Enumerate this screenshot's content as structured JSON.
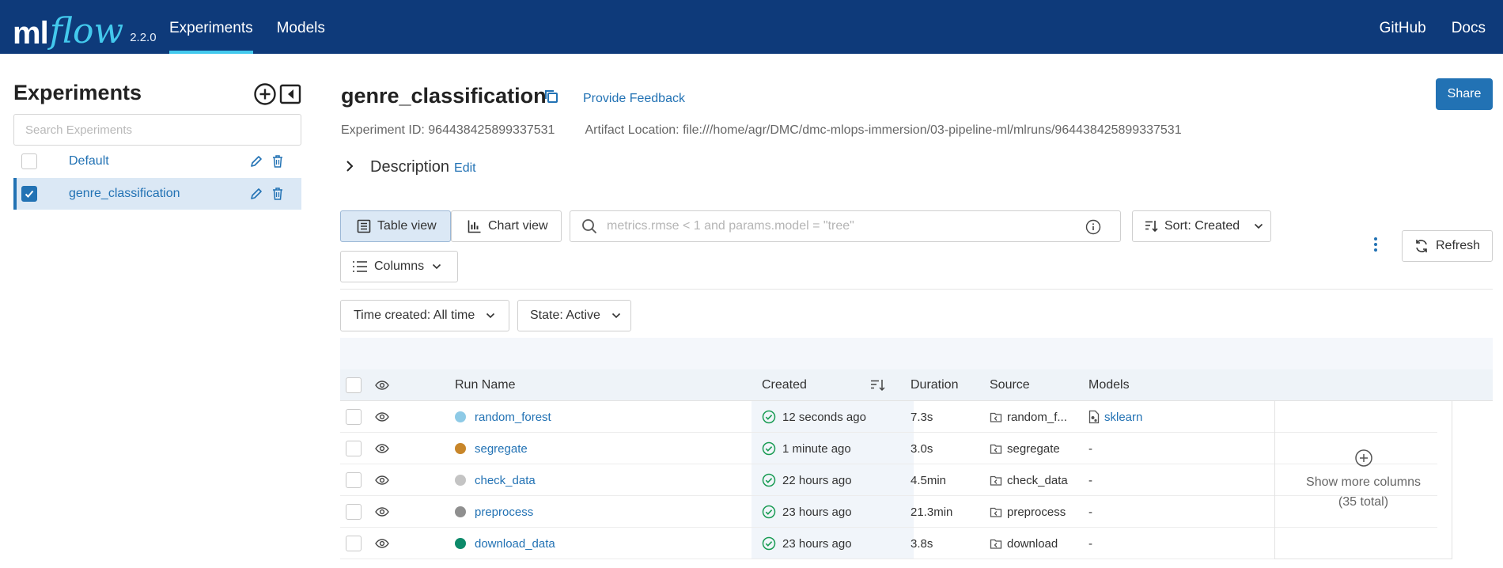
{
  "topbar": {
    "logo_ml": "ml",
    "logo_flow": "flow",
    "version": "2.2.0",
    "nav": [
      {
        "label": "Experiments",
        "active": true
      },
      {
        "label": "Models",
        "active": false
      }
    ],
    "right": [
      {
        "label": "GitHub"
      },
      {
        "label": "Docs"
      }
    ]
  },
  "sidebar": {
    "title": "Experiments",
    "search_placeholder": "Search Experiments",
    "experiments": [
      {
        "name": "Default",
        "selected": false
      },
      {
        "name": "genre_classification",
        "selected": true
      }
    ]
  },
  "experiment": {
    "title": "genre_classification",
    "feedback_label": "Provide Feedback",
    "share_label": "Share",
    "id_label": "Experiment ID:",
    "id_value": "964438425899337531",
    "artifact_label": "Artifact Location:",
    "artifact_value": "file:///home/agr/DMC/dmc-mlops-immersion/03-pipeline-ml/mlruns/964438425899337531",
    "description_label": "Description",
    "description_edit": "Edit"
  },
  "toolbar": {
    "table_view": "Table view",
    "chart_view": "Chart view",
    "search_placeholder": "metrics.rmse < 1 and params.model = \"tree\"",
    "sort_label": "Sort: Created",
    "refresh_label": "Refresh",
    "columns_label": "Columns",
    "time_filter": "Time created: All time",
    "state_filter": "State: Active"
  },
  "table": {
    "headers": {
      "run_name": "Run Name",
      "created": "Created",
      "duration": "Duration",
      "source": "Source",
      "models": "Models"
    },
    "rows": [
      {
        "name": "random_forest",
        "color": "#8ecae6",
        "created": "12 seconds ago",
        "duration": "7.3s",
        "source": "random_f...",
        "models": "sklearn",
        "has_model": true
      },
      {
        "name": "segregate",
        "color": "#c8862a",
        "created": "1 minute ago",
        "duration": "3.0s",
        "source": "segregate",
        "models": "-",
        "has_model": false
      },
      {
        "name": "check_data",
        "color": "#c4c4c4",
        "created": "22 hours ago",
        "duration": "4.5min",
        "source": "check_data",
        "models": "-",
        "has_model": false
      },
      {
        "name": "preprocess",
        "color": "#8f8f8f",
        "created": "23 hours ago",
        "duration": "21.3min",
        "source": "preprocess",
        "models": "-",
        "has_model": false
      },
      {
        "name": "download_data",
        "color": "#0d8a6a",
        "created": "23 hours ago",
        "duration": "3.8s",
        "source": "download",
        "models": "-",
        "has_model": false
      }
    ],
    "more_columns_line1": "Show more columns",
    "more_columns_line2": "(35 total)"
  },
  "colors": {
    "header_bg": "#0e3a7a",
    "accent": "#2272b4",
    "success": "#1a9c54"
  }
}
